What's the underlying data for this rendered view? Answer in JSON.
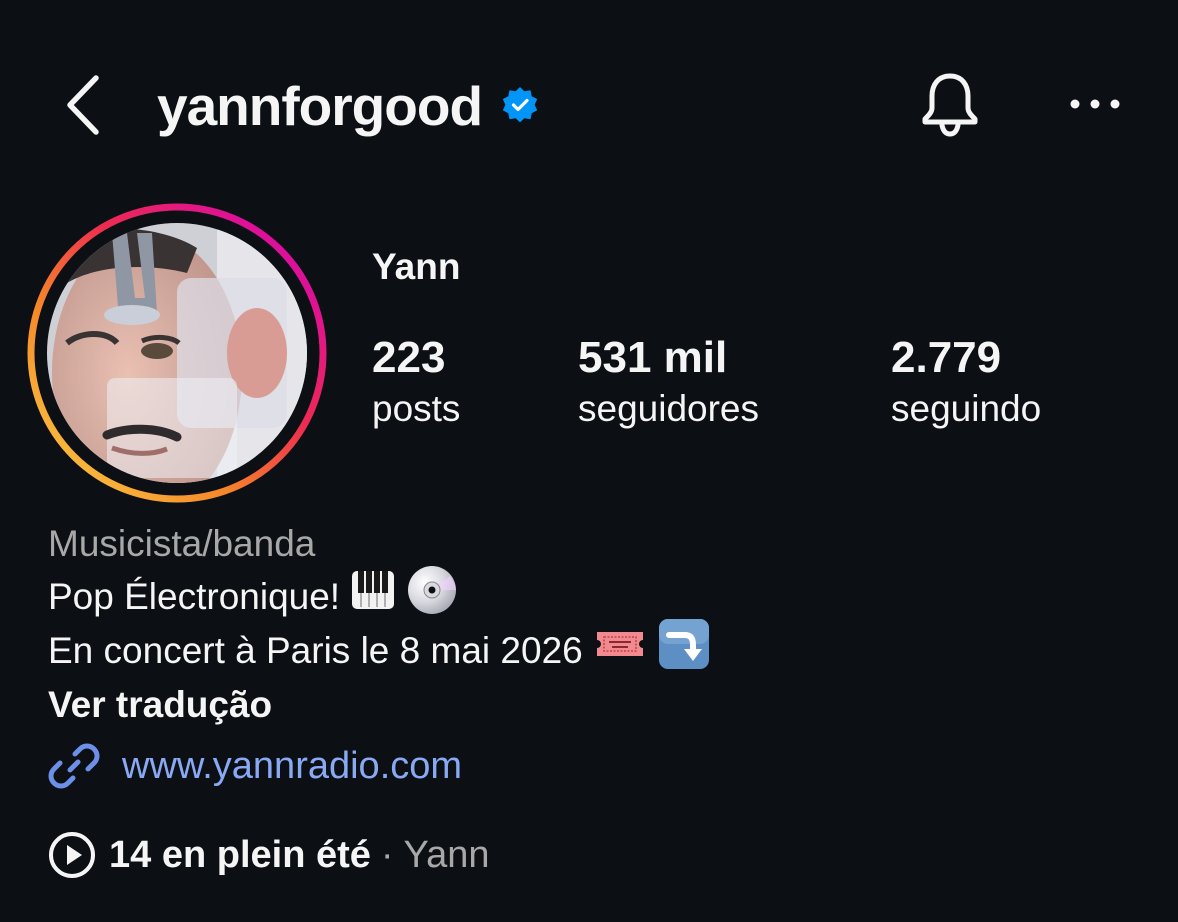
{
  "header": {
    "username": "yannforgood",
    "verified": true,
    "icons": {
      "back": "chevron-left-icon",
      "verified": "verified-badge-icon",
      "notifications": "bell-icon",
      "more": "more-horizontal-icon"
    }
  },
  "profile": {
    "display_name": "Yann",
    "has_story_ring": true,
    "stats": [
      {
        "value": "223",
        "label": "posts"
      },
      {
        "value": "531 mil",
        "label": "seguidores"
      },
      {
        "value": "2.779",
        "label": "seguindo"
      }
    ]
  },
  "bio": {
    "category": "Musicista/banda",
    "line1": "Pop Électronique!",
    "line1_emojis": [
      "musical-keyboard",
      "dvd"
    ],
    "line2": "En concert à Paris le 8 mai 2026",
    "line2_emojis": [
      "admission-tickets",
      "arrow-curving-down"
    ],
    "translate_label": "Ver tradução",
    "link": "www.yannradio.com"
  },
  "music": {
    "title": "14 en plein été",
    "separator": "·",
    "artist": "Yann"
  },
  "colors": {
    "background": "#0c1014",
    "text": "#f5f5f5",
    "secondary_text": "#a8a8a8",
    "link": "#8aa9f5",
    "verified": "#0095f6"
  }
}
